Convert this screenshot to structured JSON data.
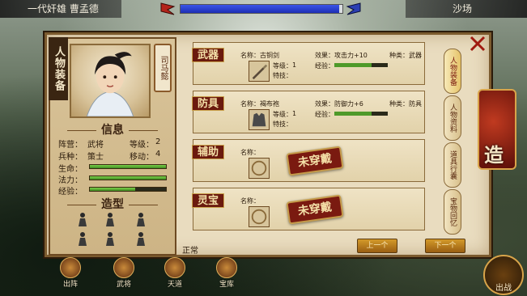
{
  "top_bar": {
    "hero_name": "一代奸雄 曹孟德",
    "location": "沙场",
    "progress_fraction": 0.98
  },
  "character_panel": {
    "title": "人物装备",
    "hero_scroll_name": "司马懿",
    "info_title": "信息",
    "camp_label": "阵营：",
    "camp_value": "武将",
    "level_label": "等级：",
    "level_value": "2",
    "type_label": "兵种：",
    "type_value": "策士",
    "move_label": "移动：",
    "move_value": "4",
    "hp_label": "生命：",
    "mp_label": "法力：",
    "exp_label": "经验：",
    "model_title": "造型"
  },
  "slots": [
    {
      "tag": "武器",
      "name_label": "名称：",
      "name_value": "古铜剑",
      "level_label": "等级：",
      "level_value": "1",
      "effect_label": "效果：",
      "effect_value": "攻击力+10",
      "kind_label": "种类：",
      "kind_value": "武器",
      "exp_label": "经验：",
      "special_label": "特技："
    },
    {
      "tag": "防具",
      "name_label": "名称：",
      "name_value": "褐布袍",
      "level_label": "等级：",
      "level_value": "1",
      "effect_label": "效果：",
      "effect_value": "防御力+6",
      "kind_label": "种类：",
      "kind_value": "防具",
      "exp_label": "经验：",
      "special_label": "特技："
    },
    {
      "tag": "辅助",
      "name_label": "名称：",
      "stamp": "未穿戴"
    },
    {
      "tag": "灵宝",
      "name_label": "名称：",
      "stamp": "未穿戴"
    }
  ],
  "side_tabs": [
    "人物装备",
    "人物资料",
    "道具行囊",
    "宝物回忆"
  ],
  "footer": {
    "status": "正常",
    "prev": "上一个",
    "next": "下一个"
  },
  "bottom_bar": [
    "出阵",
    "武将",
    "天道",
    "宝库"
  ],
  "forge_seal": "造",
  "battle_label": "出战"
}
